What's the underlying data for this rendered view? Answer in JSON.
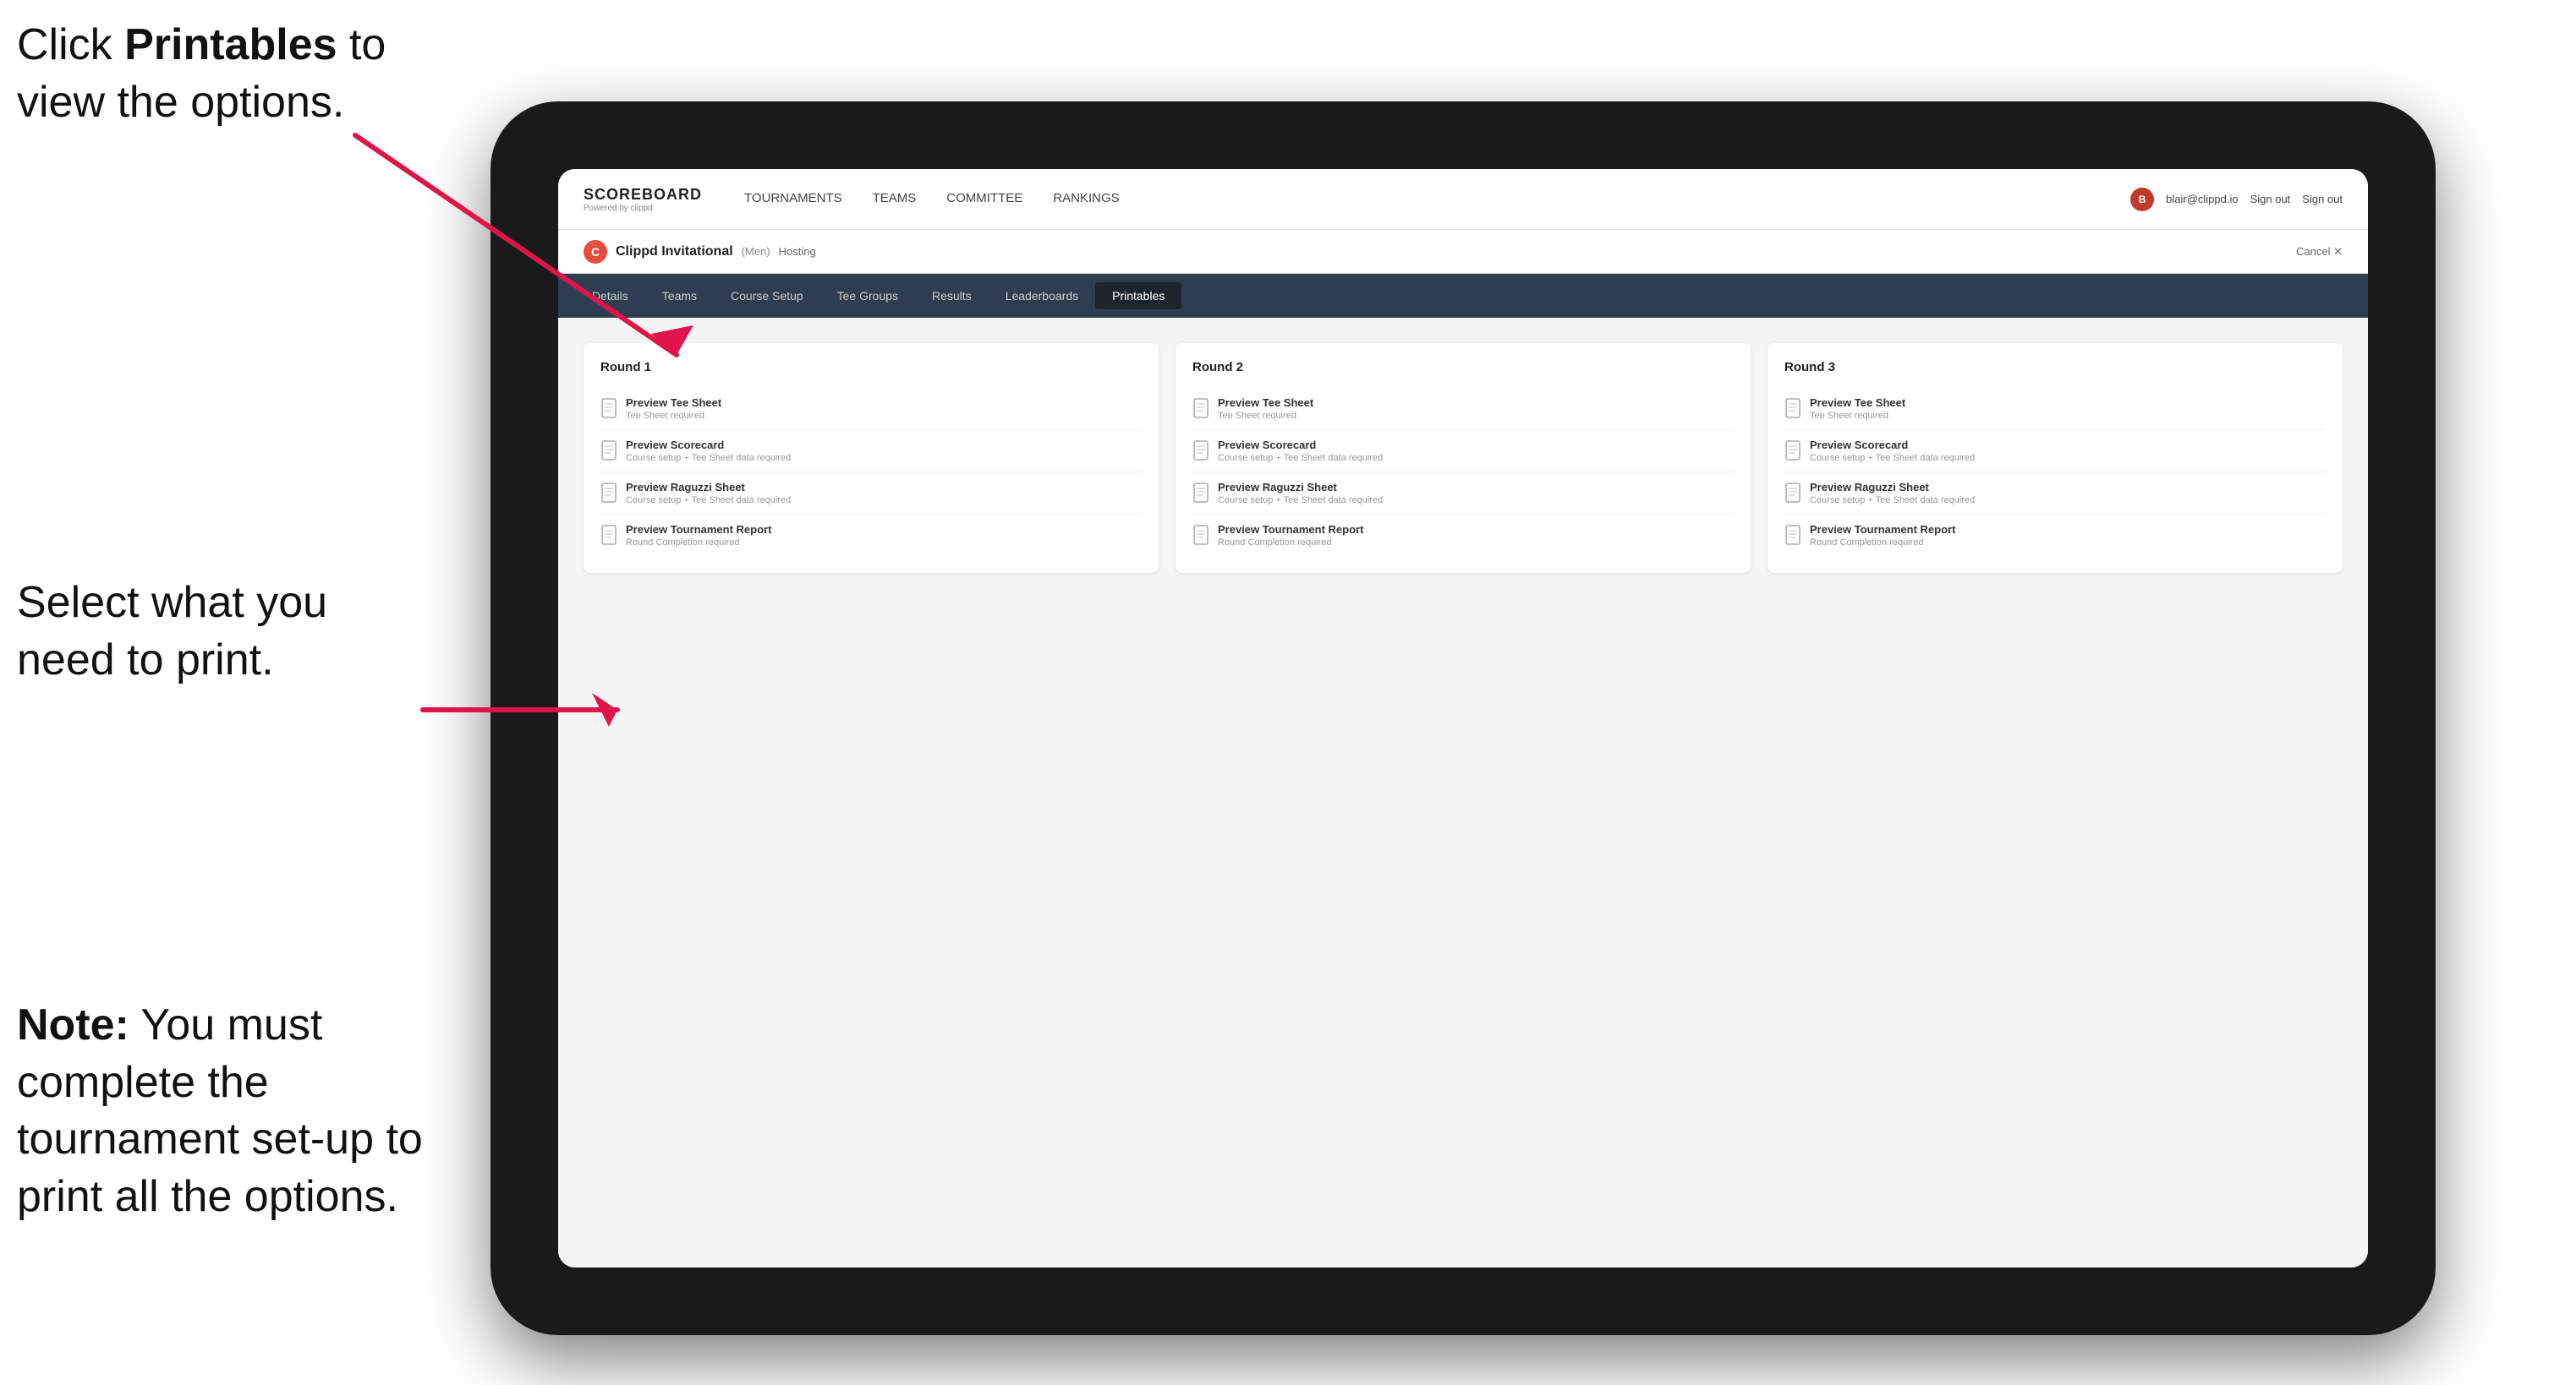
{
  "annotation": {
    "top_line1": "Click ",
    "top_bold": "Printables",
    "top_line2": " to",
    "top_line3": "view the options.",
    "middle_line1": "Select what you",
    "middle_line2": "need to print.",
    "bottom_note": "Note:",
    "bottom_text": " You must complete the tournament set-up to print all the options."
  },
  "nav": {
    "logo_title": "SCOREBOARD",
    "logo_sub": "Powered by clippd",
    "links": [
      {
        "label": "TOURNAMENTS",
        "active": false
      },
      {
        "label": "TEAMS",
        "active": false
      },
      {
        "label": "COMMITTEE",
        "active": false
      },
      {
        "label": "RANKINGS",
        "active": false
      }
    ],
    "user_email": "blair@clippd.io",
    "sign_out": "Sign out"
  },
  "tournament": {
    "name": "Clippd Invitational",
    "tag": "(Men)",
    "status": "Hosting",
    "cancel": "Cancel ✕"
  },
  "tabs": [
    {
      "label": "Details",
      "active": false
    },
    {
      "label": "Teams",
      "active": false
    },
    {
      "label": "Course Setup",
      "active": false
    },
    {
      "label": "Tee Groups",
      "active": false
    },
    {
      "label": "Results",
      "active": false
    },
    {
      "label": "Leaderboards",
      "active": false
    },
    {
      "label": "Printables",
      "active": true
    }
  ],
  "rounds": [
    {
      "title": "Round 1",
      "items": [
        {
          "title": "Preview Tee Sheet",
          "subtitle": "Tee Sheet required"
        },
        {
          "title": "Preview Scorecard",
          "subtitle": "Course setup + Tee Sheet data required"
        },
        {
          "title": "Preview Raguzzi Sheet",
          "subtitle": "Course setup + Tee Sheet data required"
        },
        {
          "title": "Preview Tournament Report",
          "subtitle": "Round Completion required"
        }
      ]
    },
    {
      "title": "Round 2",
      "items": [
        {
          "title": "Preview Tee Sheet",
          "subtitle": "Tee Sheet required"
        },
        {
          "title": "Preview Scorecard",
          "subtitle": "Course setup + Tee Sheet data required"
        },
        {
          "title": "Preview Raguzzi Sheet",
          "subtitle": "Course setup + Tee Sheet data required"
        },
        {
          "title": "Preview Tournament Report",
          "subtitle": "Round Completion required"
        }
      ]
    },
    {
      "title": "Round 3",
      "items": [
        {
          "title": "Preview Tee Sheet",
          "subtitle": "Tee Sheet required"
        },
        {
          "title": "Preview Scorecard",
          "subtitle": "Course setup + Tee Sheet data required"
        },
        {
          "title": "Preview Raguzzi Sheet",
          "subtitle": "Course setup + Tee Sheet data required"
        },
        {
          "title": "Preview Tournament Report",
          "subtitle": "Round Completion required"
        }
      ]
    }
  ],
  "colors": {
    "accent": "#e74c3c",
    "nav_bg": "#2c3e50",
    "arrow_color": "#e0134a"
  }
}
